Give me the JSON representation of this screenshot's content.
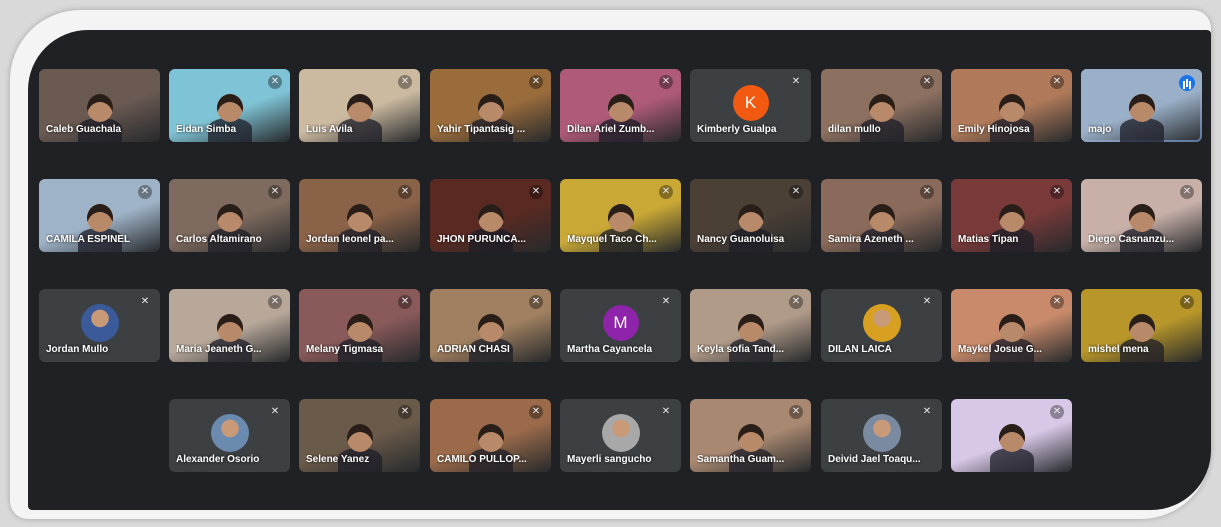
{
  "meeting": {
    "participants": [
      {
        "name": "Caleb Guachala",
        "muted": false,
        "video": true,
        "bg": "#6a5a52"
      },
      {
        "name": "Eidan Simba",
        "muted": true,
        "video": true,
        "bg": "#7fc4d6"
      },
      {
        "name": "Luis Avila",
        "muted": true,
        "video": true,
        "bg": "#cbb9a0"
      },
      {
        "name": "Yahir Tipantasig ...",
        "muted": true,
        "video": true,
        "bg": "#9a6c3c"
      },
      {
        "name": "Dilan Ariel Zumb...",
        "muted": true,
        "video": true,
        "bg": "#b05a7a"
      },
      {
        "name": "Kimberly Gualpa",
        "muted": true,
        "video": false,
        "avatar_letter": "K",
        "avatar_color": "#f25a12"
      },
      {
        "name": "dilan mullo",
        "muted": true,
        "video": true,
        "bg": "#8c7060"
      },
      {
        "name": "Emily Hinojosa",
        "muted": true,
        "video": true,
        "bg": "#b07a5a"
      },
      {
        "name": "majo",
        "muted": false,
        "speaking": true,
        "video": true,
        "bg": "#9ab0c8"
      },
      {
        "name": "CAMILA ESPINEL",
        "muted": true,
        "video": true,
        "bg": "#9fb3c8"
      },
      {
        "name": "Carlos Altamirano",
        "muted": true,
        "video": true,
        "bg": "#7e6a5e"
      },
      {
        "name": "Jordan leonel pa...",
        "muted": true,
        "video": true,
        "bg": "#8a6248"
      },
      {
        "name": "JHON PURUNCA...",
        "muted": true,
        "video": true,
        "bg": "#5a2a22"
      },
      {
        "name": "Mayquel Taco Ch...",
        "muted": true,
        "video": true,
        "bg": "#c9a836"
      },
      {
        "name": "Nancy Guanoluisa",
        "muted": true,
        "video": true,
        "bg": "#4a4036"
      },
      {
        "name": "Samira Azeneth ...",
        "muted": true,
        "video": true,
        "bg": "#8a6a5a"
      },
      {
        "name": "Matias Tipan",
        "muted": true,
        "video": true,
        "bg": "#7a3a3a"
      },
      {
        "name": "Diego Casnanzu...",
        "muted": true,
        "video": true,
        "bg": "#c8b0a8"
      },
      {
        "name": "Jordan Mullo",
        "muted": true,
        "video": false,
        "photo_color": "#3a5a9a"
      },
      {
        "name": "Maria Jeaneth G...",
        "muted": true,
        "video": true,
        "bg": "#b8a89a"
      },
      {
        "name": "Melany Tigmasa",
        "muted": true,
        "video": true,
        "bg": "#8a5a5a"
      },
      {
        "name": "ADRIAN CHASI",
        "muted": true,
        "video": true,
        "bg": "#a08060"
      },
      {
        "name": "Martha Cayancela",
        "muted": true,
        "video": false,
        "avatar_letter": "M",
        "avatar_color": "#8e24aa"
      },
      {
        "name": "Keyla sofia Tand...",
        "muted": true,
        "video": true,
        "bg": "#b09a88"
      },
      {
        "name": "DILAN LAICA",
        "muted": true,
        "video": false,
        "photo_color": "#d8a020"
      },
      {
        "name": "Maykel Josue G...",
        "muted": true,
        "video": true,
        "bg": "#c88a6a"
      },
      {
        "name": "mishel mena",
        "muted": true,
        "video": true,
        "bg": "#b8962a"
      },
      {
        "name": "Alexander Osorio",
        "muted": true,
        "video": false,
        "photo_color": "#6a8ab0"
      },
      {
        "name": "Selene Yanez",
        "muted": true,
        "video": true,
        "bg": "#6a5a4a"
      },
      {
        "name": "CAMILO PULLOP...",
        "muted": true,
        "video": true,
        "bg": "#9a6a4a"
      },
      {
        "name": "Mayerli sangucho",
        "muted": true,
        "video": false,
        "photo_color": "#a8a8a8"
      },
      {
        "name": "Samantha Guam...",
        "muted": true,
        "video": true,
        "bg": "#a88870"
      },
      {
        "name": "Deivid Jael Toaqu...",
        "muted": true,
        "video": false,
        "photo_color": "#7a8aa0"
      },
      {
        "name": "",
        "muted": true,
        "video": true,
        "bg": "#d8c8e8"
      }
    ]
  }
}
